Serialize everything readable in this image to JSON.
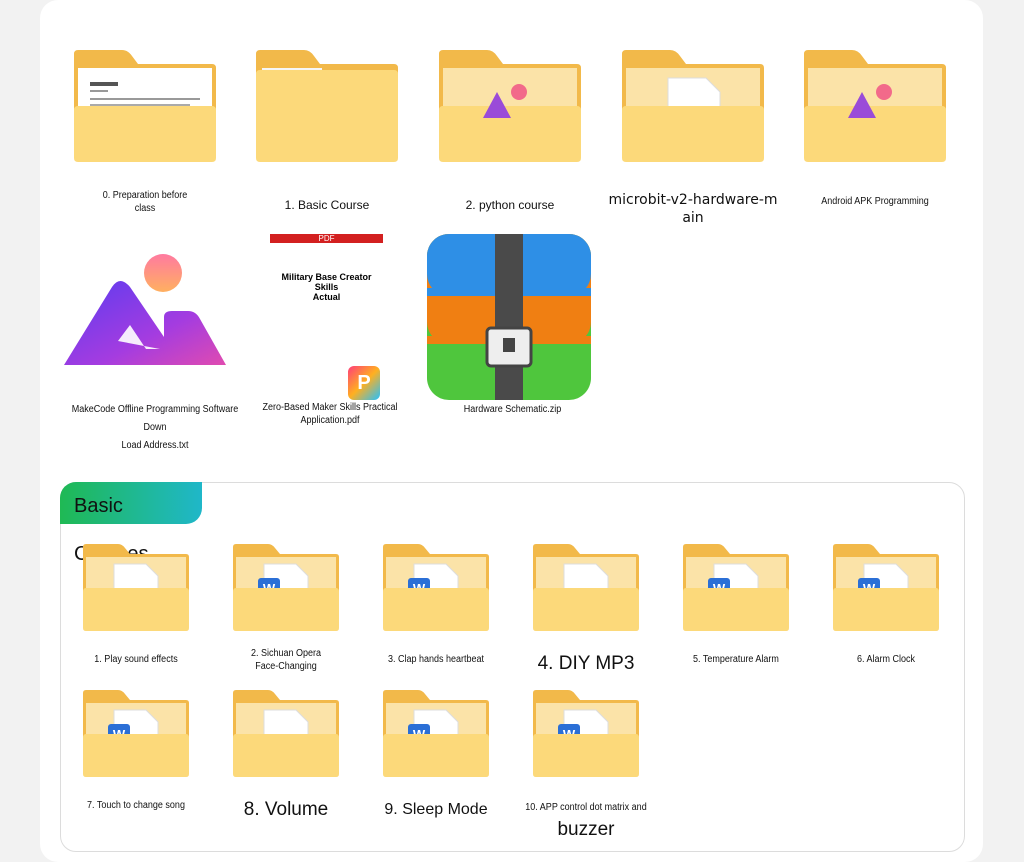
{
  "top_files": [
    {
      "label": "0. Preparation before\nclass",
      "kind": "folder-docs"
    },
    {
      "label": "1. Basic Course",
      "kind": "folder-empty"
    },
    {
      "label": "2. python course",
      "kind": "folder-image"
    },
    {
      "label": "microbit-v2-hardware-m\nain",
      "kind": "folder-file"
    },
    {
      "label": "Android APK Programming",
      "kind": "folder-image"
    },
    {
      "label": "MakeCode Offline Programming Software Down\nLoad Address.txt",
      "kind": "app-image"
    },
    {
      "label": "Zero-Based Maker Skills Practical Application.pdf",
      "kind": "pdf"
    },
    {
      "label": "Hardware Schematic.zip",
      "kind": "zip"
    }
  ],
  "pdf_preview": {
    "banner": "PDF",
    "title": "Military Base Creator Skills\nActual"
  },
  "section": {
    "title": "Basic Courses"
  },
  "course_items": [
    {
      "label": "1. Play sound effects",
      "kind": "folder-file"
    },
    {
      "label": "2. Sichuan Opera\nFace-Changing",
      "kind": "folder-word"
    },
    {
      "label": "3. Clap hands heartbeat",
      "kind": "folder-word"
    },
    {
      "label": "4. DIY MP3",
      "kind": "folder-file"
    },
    {
      "label": "5. Temperature Alarm",
      "kind": "folder-word"
    },
    {
      "label": "6. Alarm Clock",
      "kind": "folder-word"
    },
    {
      "label": "7. Touch to change song",
      "kind": "folder-word"
    },
    {
      "label": "8. Volume",
      "kind": "folder-file"
    },
    {
      "label": "9. Sleep Mode",
      "kind": "folder-word"
    },
    {
      "label": "10. APP control dot matrix and",
      "label2": "buzzer",
      "kind": "folder-word"
    }
  ],
  "icons": {
    "folder": "folder-icon",
    "word": "word-document-icon",
    "image": "image-icon",
    "pdf": "pdf-icon",
    "zip": "zip-archive-icon"
  },
  "colors": {
    "folder_back": "#f2b94a",
    "folder_front": "#fcd97a",
    "word_blue": "#2b6fd6",
    "section_green": "#1fb954",
    "section_teal": "#1fb7c9"
  }
}
